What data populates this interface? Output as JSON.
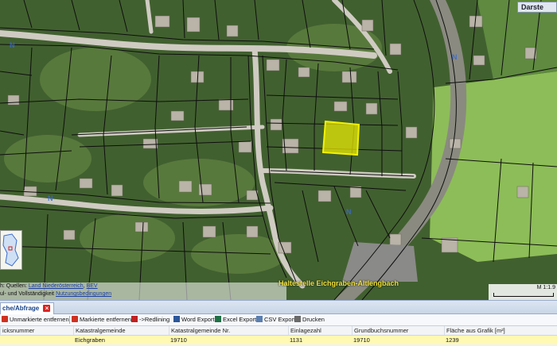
{
  "map": {
    "top_right_button": "Darste",
    "attribution_line1_prefix": "h: Quellen:",
    "attribution_line1_link1": "Land Niederösterreich",
    "attribution_line1_link2": "BEV",
    "attribution_line2_prefix": "ul- und Vollständigkeit",
    "attribution_line2_link": "Nutzungsbedingungen",
    "place_label": "Haltestelle Eichgraben-Altlengbach",
    "scale_label": "M 1:1.9",
    "colors": {
      "parcel_lines": "#101010",
      "highlight_parcel": "#f2f200",
      "road": "#c9c7c0",
      "vegetation": "#4a6b34",
      "meadow": "#8fbf5a"
    }
  },
  "panel": {
    "tab_label": "che/Abfrage",
    "toolbar": [
      {
        "label": "Unmarkierte entfernen",
        "icon": "remove-unmarked-icon",
        "color": "#d03020"
      },
      {
        "label": "Markierte entfernen",
        "icon": "remove-marked-icon",
        "color": "#d03020"
      },
      {
        "label": "->Redlining",
        "icon": "redlining-icon",
        "color": "#c02020"
      },
      {
        "label": "Word Export",
        "icon": "word-icon",
        "color": "#2b579a"
      },
      {
        "label": "Excel Export",
        "icon": "excel-icon",
        "color": "#1e7145"
      },
      {
        "label": "CSV Export",
        "icon": "csv-icon",
        "color": "#5a7fb0"
      },
      {
        "label": "Drucken",
        "icon": "printer-icon",
        "color": "#6a6a6a"
      }
    ],
    "columns": [
      "icksnummer",
      "Katastralgemeinde",
      "Katastralgemeinde Nr.",
      "Einlagezahl",
      "Grundbuchsnummer",
      "Fläche aus Grafik [m²]"
    ],
    "rows": [
      [
        "",
        "Eichgraben",
        "19710",
        "1131",
        "19710",
        "1239"
      ]
    ]
  }
}
